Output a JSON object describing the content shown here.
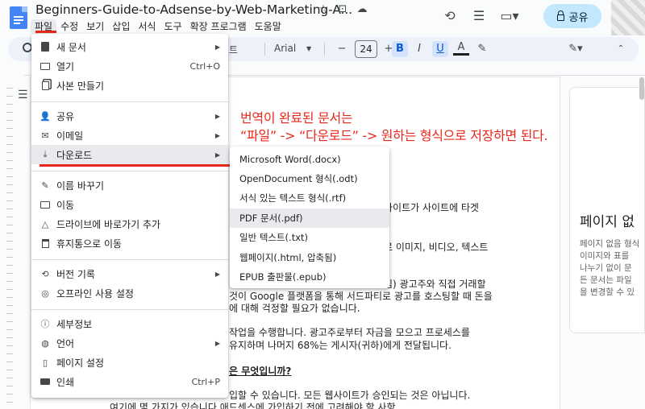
{
  "titlebar": {
    "doc_title": "Beginners-Guide-to-Adsense-by-Web-Marketing-A...",
    "share_label": "공유"
  },
  "menubar": {
    "items": [
      "파일",
      "수정",
      "보기",
      "삽입",
      "서식",
      "도구",
      "확장 프로그램",
      "도움말"
    ]
  },
  "toolbar": {
    "style_text": "트",
    "font_name": "Arial",
    "font_size": "24",
    "font_minus": "−",
    "font_plus": "+",
    "bold": "B",
    "italic": "I",
    "underline": "U",
    "text_color": "A"
  },
  "file_menu": {
    "items": [
      {
        "label": "새 문서",
        "icon": "new-doc-icon",
        "arrow": true
      },
      {
        "label": "열기",
        "icon": "open-folder-icon",
        "shortcut": "Ctrl+O"
      },
      {
        "label": "사본 만들기",
        "icon": "copy-icon"
      },
      {
        "label": "공유",
        "icon": "share-person-icon",
        "arrow": true
      },
      {
        "label": "이메일",
        "icon": "email-icon",
        "arrow": true
      },
      {
        "label": "다운로드",
        "icon": "download-icon",
        "arrow": true
      },
      {
        "label": "이름 바꾸기",
        "icon": "rename-icon"
      },
      {
        "label": "이동",
        "icon": "move-folder-icon"
      },
      {
        "label": "드라이브에 바로가기 추가",
        "icon": "drive-shortcut-icon"
      },
      {
        "label": "휴지통으로 이동",
        "icon": "trash-icon"
      },
      {
        "label": "버전 기록",
        "icon": "history-icon",
        "arrow": true
      },
      {
        "label": "오프라인 사용 설정",
        "icon": "offline-icon"
      },
      {
        "label": "세부정보",
        "icon": "info-icon"
      },
      {
        "label": "언어",
        "icon": "globe-icon",
        "arrow": true
      },
      {
        "label": "페이지 설정",
        "icon": "page-setup-icon"
      },
      {
        "label": "인쇄",
        "icon": "print-icon",
        "shortcut": "Ctrl+P"
      }
    ]
  },
  "download_menu": {
    "items": [
      "Microsoft Word(.docx)",
      "OpenDocument 형식(.odt)",
      "서식 있는 텍스트 형식(.rtf)",
      "PDF 문서(.pdf)",
      "일반 텍스트(.txt)",
      "웹페이지(.html, 압축됨)",
      "EPUB 출판물(.epub)"
    ]
  },
  "annotation": {
    "line1": "번역이 완료된 문서는",
    "line2": "“파일” -> “다운로드” -> 원하는 형식으로 저장하면 된다."
  },
  "document": {
    "lines": [
      "사이트가 사이트에 타겟",
      "로 이미지, 비디오, 텍스트",
      "임) 광고주와 직접 거래할",
      "것이 Google 플랫폼을 통해 서드파티로 광고를 호스팅할 때 돈을",
      "에 대해 걱정할 필요가 없습니다.",
      "작업을 수행합니다. 광고주로부터 자금을 모으고 프로세스를",
      "유지하며 나머지 68%는 게시자(귀하)에게 전달됩니다.",
      "은 무엇입니까?",
      "입할 수 있습니다. 모든 웹사이트가 승인되는 것은 아닙니다.",
      "여기에 몇 가지가 있습니다 애드센스에 가입하기 전에 고려해야 할 사항"
    ]
  },
  "side_panel": {
    "title": "페이지 없",
    "lines": [
      "페이지 없음 형식",
      "이미지와 표를 ",
      "나누기 없이 문",
      "든 문서는 파일",
      "을 변경할 수 있"
    ]
  },
  "colors": {
    "accent_red": "#e8281b",
    "share_bg": "#c2e7ff",
    "toolbar_bg": "#edf2fa",
    "highlight": "#e8eaed"
  }
}
